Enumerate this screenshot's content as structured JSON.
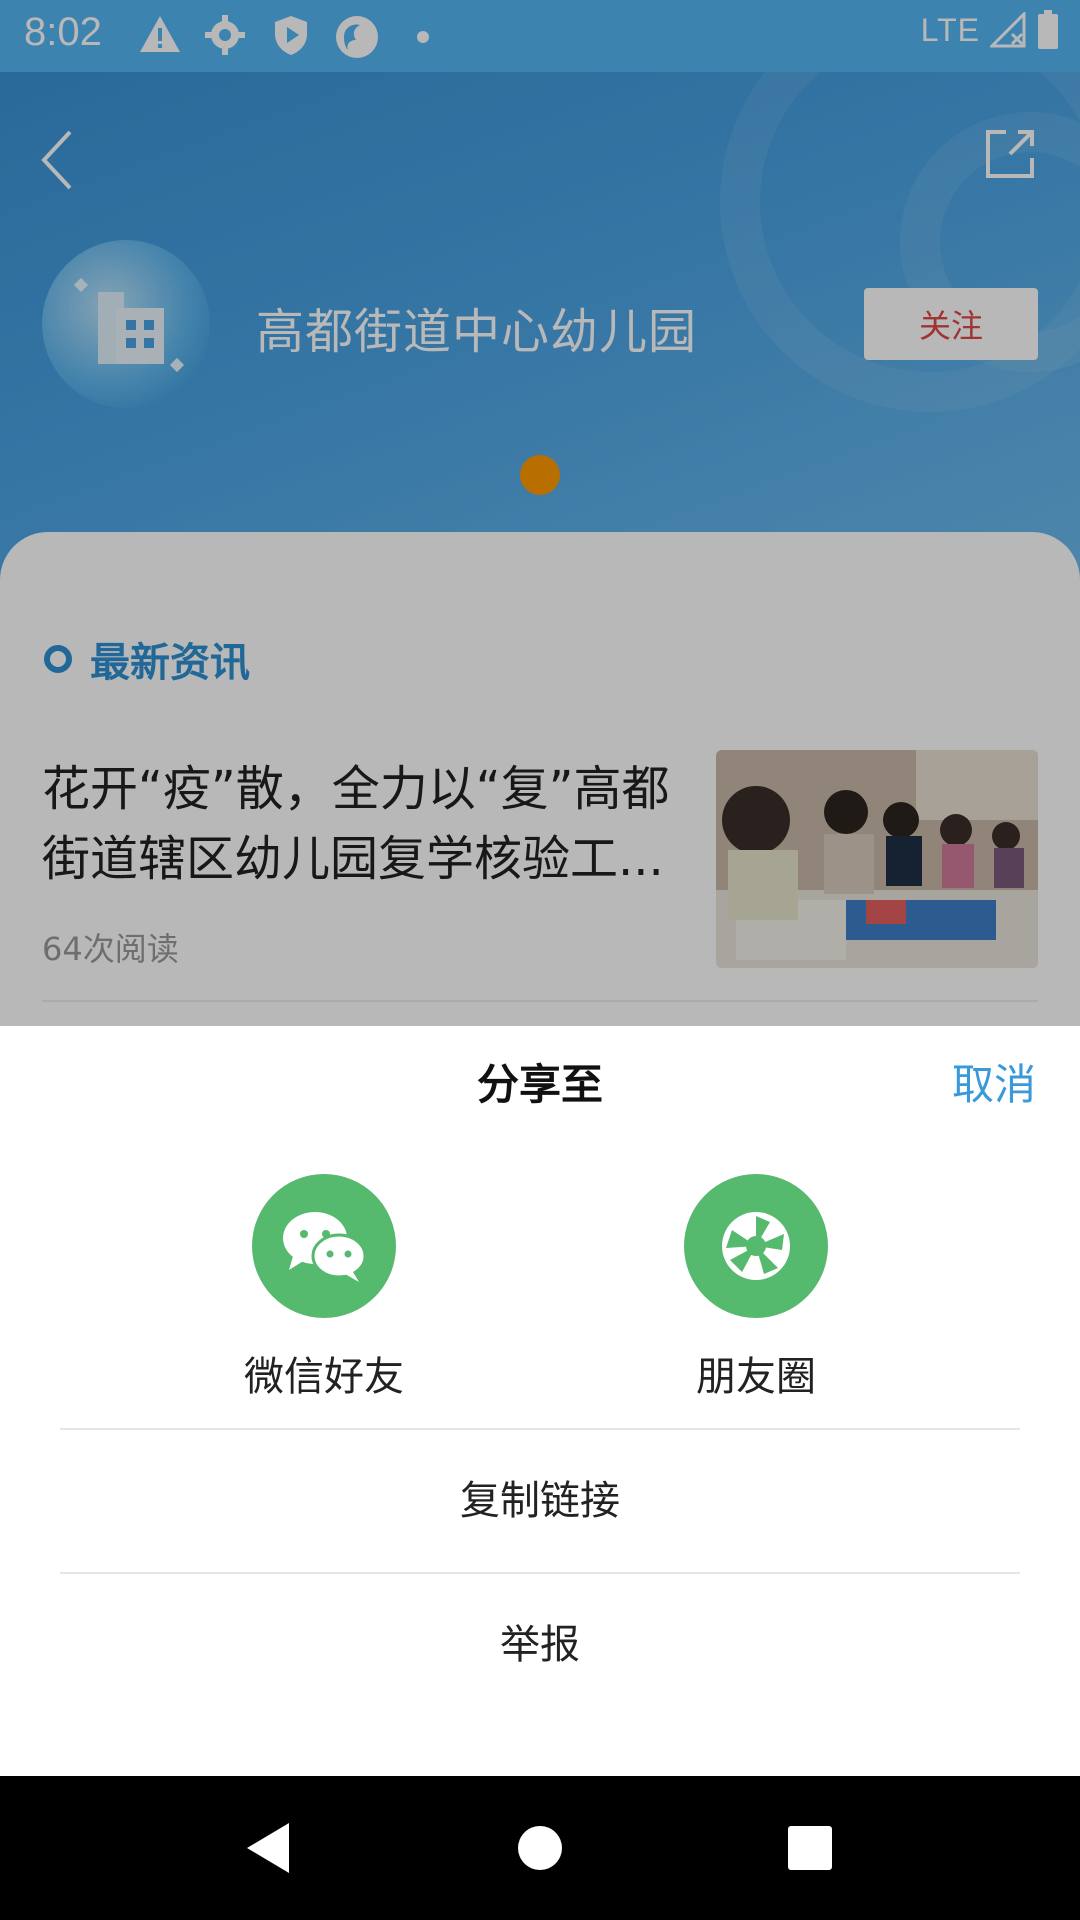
{
  "status_bar": {
    "time": "8:02",
    "network": "LTE",
    "icons": [
      "alert-icon",
      "settings-icon",
      "shield-icon",
      "app-icon",
      "dot-icon",
      "signal-icon",
      "battery-icon"
    ]
  },
  "header": {
    "org_name": "高都街道中心幼儿园",
    "follow_label": "关注",
    "pager_active_index": 0,
    "colors": {
      "gradient_start": "#3a93d6",
      "gradient_end": "#6cbbee",
      "follow_text": "#e04747",
      "pager_dot": "#ff9a00"
    }
  },
  "news": {
    "section_title": "最新资讯",
    "items": [
      {
        "title": "花开“疫”散，全力以“复”高都街道辖区幼儿园复学核验工...",
        "reads": "64次阅读"
      }
    ]
  },
  "share_sheet": {
    "title": "分享至",
    "cancel_label": "取消",
    "targets": [
      {
        "label": "微信好友",
        "icon": "wechat-icon"
      },
      {
        "label": "朋友圈",
        "icon": "moments-icon"
      }
    ],
    "copy_link_label": "复制链接",
    "report_label": "举报",
    "colors": {
      "accent": "#3a9ad9",
      "icon_bg": "#55b96e"
    }
  },
  "nav_bar": {
    "buttons": [
      "back-triangle-icon",
      "home-circle-icon",
      "recents-square-icon"
    ]
  }
}
